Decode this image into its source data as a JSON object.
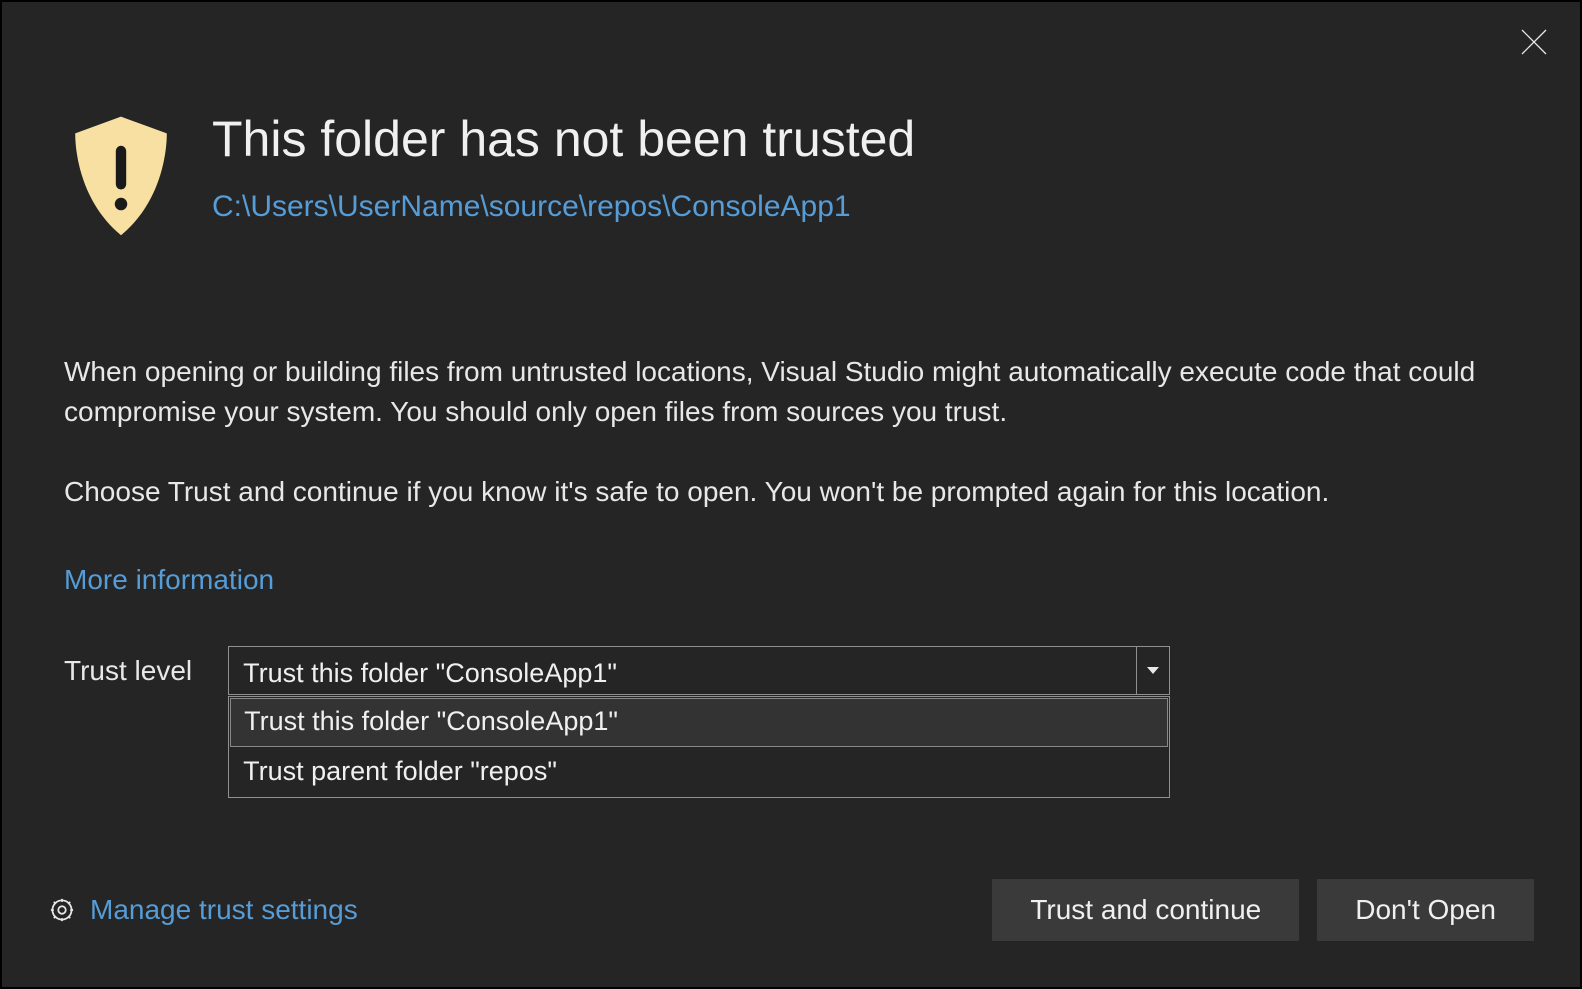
{
  "header": {
    "title": "This folder has not been trusted",
    "path": "C:\\Users\\UserName\\source\\repos\\ConsoleApp1"
  },
  "body": {
    "p1": "When opening or building files from untrusted locations, Visual Studio might automatically execute code that could compromise your system. You should only open files from sources you trust.",
    "p2": "Choose Trust and continue if you know it's safe to open. You won't be prompted again for this location.",
    "more_info": "More information"
  },
  "trust": {
    "label": "Trust level",
    "selected": "Trust this folder \"ConsoleApp1\"",
    "options": [
      "Trust this folder \"ConsoleApp1\"",
      "Trust parent folder \"repos\""
    ]
  },
  "footer": {
    "settings": "Manage trust settings",
    "trust_btn": "Trust and continue",
    "dont_open_btn": "Don't Open"
  }
}
